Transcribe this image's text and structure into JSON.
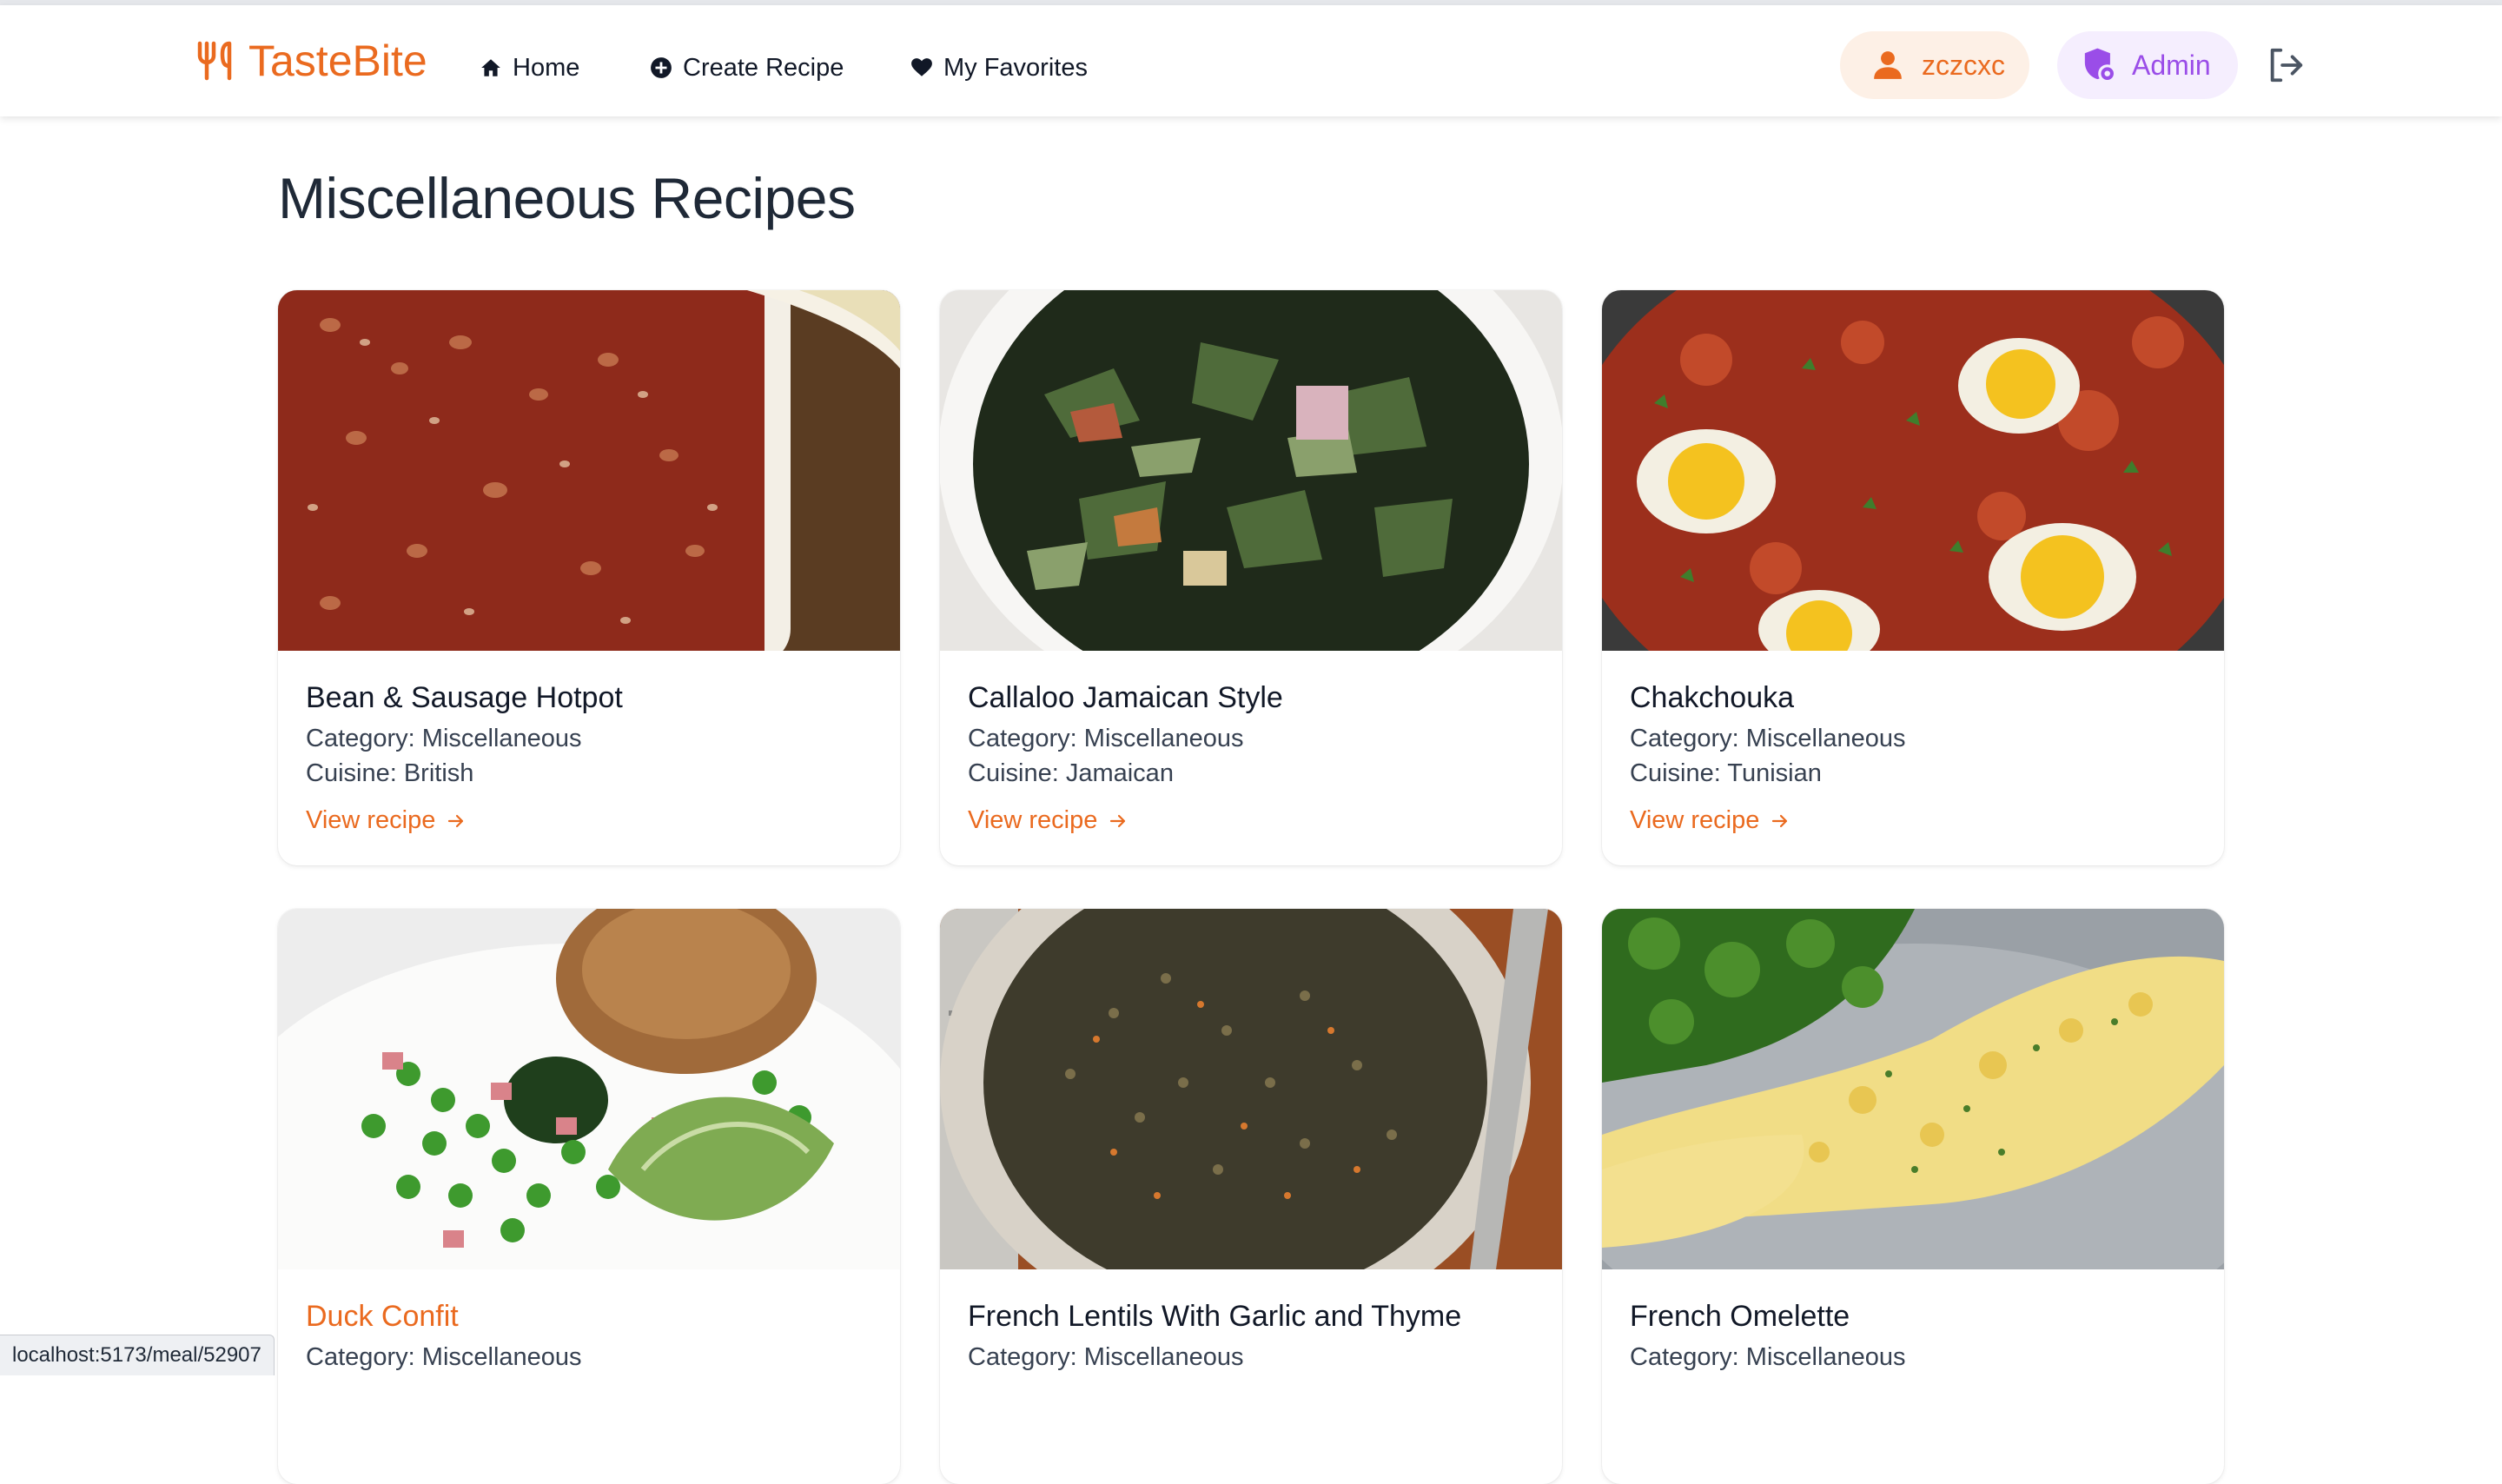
{
  "header": {
    "brand": "TasteBite",
    "nav": [
      {
        "label": "Home",
        "icon": "home-icon"
      },
      {
        "label": "Create Recipe",
        "icon": "plus-circle-icon"
      },
      {
        "label": "My Favorites",
        "icon": "heart-icon"
      }
    ],
    "user": {
      "name": "zczcxc",
      "icon": "user-icon"
    },
    "admin": {
      "label": "Admin",
      "icon": "shield-icon"
    },
    "logout_icon": "logout-icon"
  },
  "page": {
    "title": "Miscellaneous Recipes"
  },
  "recipes": [
    {
      "title": "Bean & Sausage Hotpot",
      "category": "Category: Miscellaneous",
      "cuisine": "Cuisine: British",
      "link": "View recipe"
    },
    {
      "title": "Callaloo Jamaican Style",
      "category": "Category: Miscellaneous",
      "cuisine": "Cuisine: Jamaican",
      "link": "View recipe"
    },
    {
      "title": "Chakchouka",
      "category": "Category: Miscellaneous",
      "cuisine": "Cuisine: Tunisian",
      "link": "View recipe"
    },
    {
      "title": "Duck Confit",
      "category": "Category: Miscellaneous"
    },
    {
      "title": "French Lentils With Garlic and Thyme",
      "category": "Category: Miscellaneous"
    },
    {
      "title": "French Omelette",
      "category": "Category: Miscellaneous"
    }
  ],
  "status_bar": {
    "url": "localhost:5173/meal/52907"
  },
  "colors": {
    "accent": "#ea6a1f",
    "admin": "#9a4de8",
    "text": "#111827"
  }
}
